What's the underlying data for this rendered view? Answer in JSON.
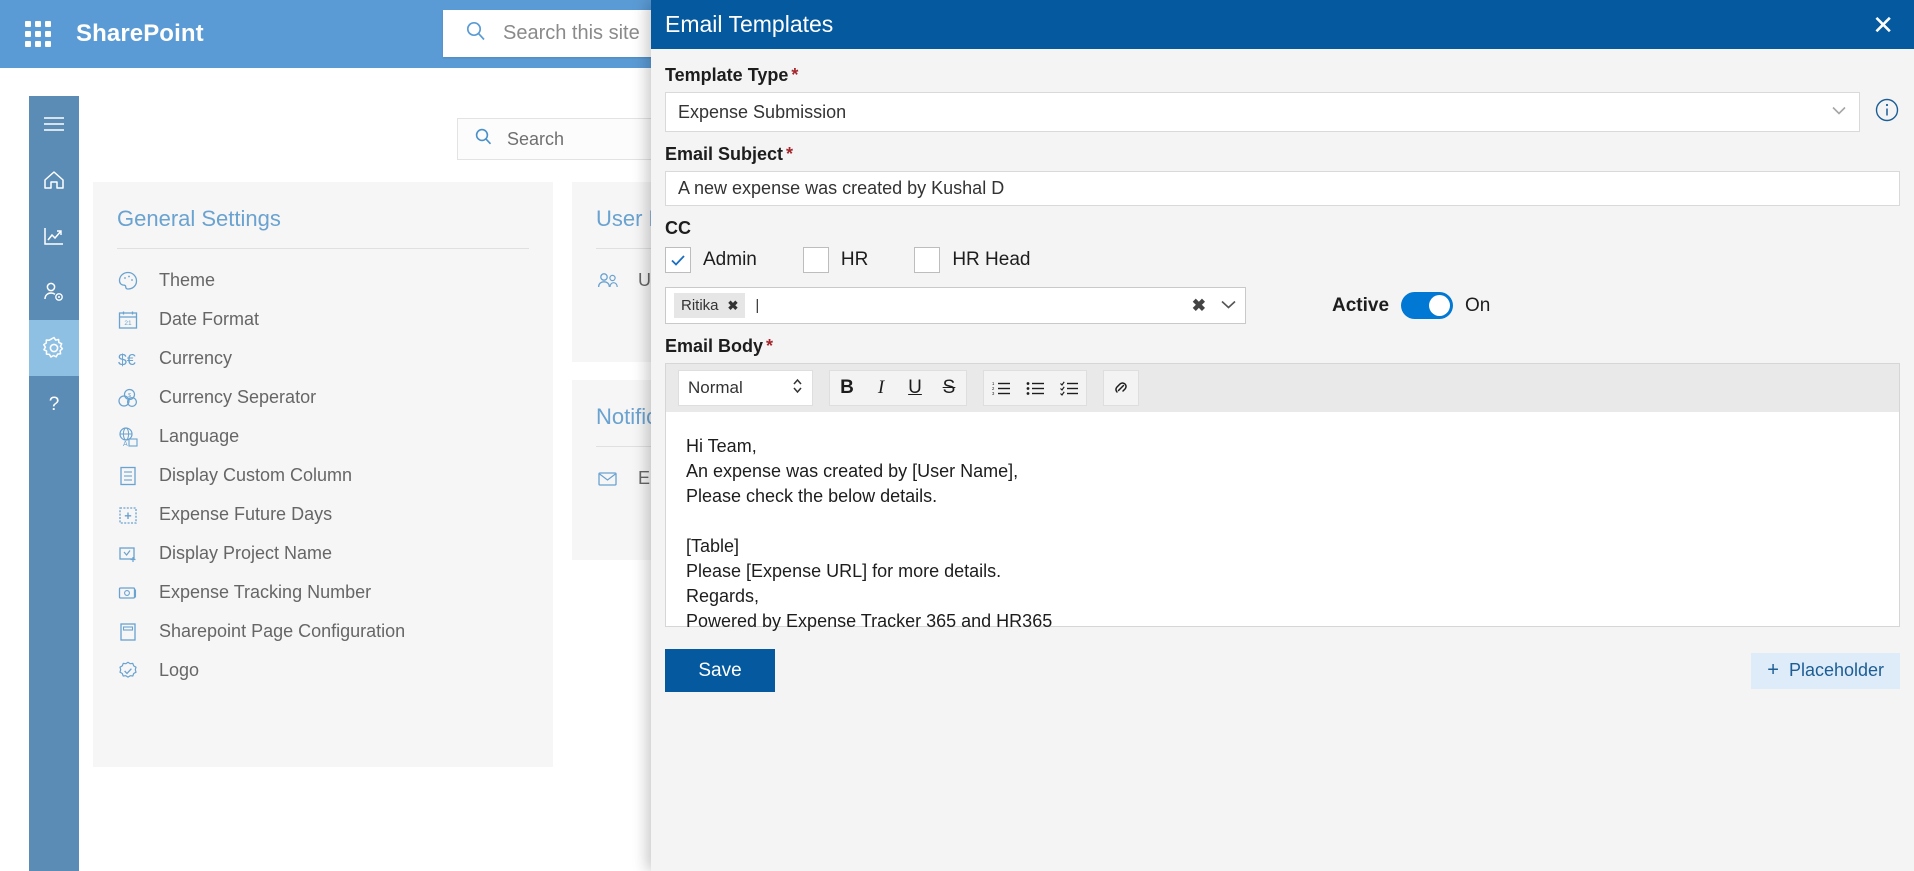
{
  "suitebar": {
    "waffle_name": "app-launcher",
    "brand": "SharePoint",
    "search_placeholder": "Search this site",
    "bg": "#5b9bd5"
  },
  "rail": {
    "items": [
      {
        "icon": "hamburger-icon",
        "name": "menu",
        "active": false
      },
      {
        "icon": "home-icon",
        "name": "home",
        "active": false
      },
      {
        "icon": "chart-icon",
        "name": "reports",
        "active": false
      },
      {
        "icon": "user-settings-icon",
        "name": "user-management",
        "active": false
      },
      {
        "icon": "gear-icon",
        "name": "settings",
        "active": true
      },
      {
        "icon": "help-icon",
        "name": "help",
        "active": false
      }
    ]
  },
  "page": {
    "search_placeholder": "Search"
  },
  "cards": {
    "general": {
      "title": "General Settings",
      "items": [
        {
          "icon": "palette-icon",
          "label": "Theme"
        },
        {
          "icon": "calendar-icon",
          "label": "Date Format"
        },
        {
          "icon": "currency-icon",
          "label": "Currency"
        },
        {
          "icon": "coins-icon",
          "label": "Currency Seperator"
        },
        {
          "icon": "language-icon",
          "label": "Language"
        },
        {
          "icon": "list-icon",
          "label": "Display Custom Column"
        },
        {
          "icon": "calendar-plus-icon",
          "label": "Expense Future Days"
        },
        {
          "icon": "folder-check-icon",
          "label": "Display Project Name"
        },
        {
          "icon": "money-icon",
          "label": "Expense Tracking Number"
        },
        {
          "icon": "page-icon",
          "label": "Sharepoint Page Configuration"
        },
        {
          "icon": "badge-check-icon",
          "label": "Logo"
        }
      ]
    },
    "user_roles": {
      "title": "User Roles",
      "items": [
        {
          "icon": "users-icon",
          "label": "Users"
        }
      ]
    },
    "notifications": {
      "title": "Notifications",
      "items": [
        {
          "icon": "email-template-icon",
          "label": "Email Templates"
        }
      ]
    }
  },
  "panel": {
    "title": "Email Templates",
    "close_label": "✕",
    "template_type": {
      "label": "Template Type",
      "required": "*",
      "value": "Expense Submission",
      "chevron": "⌄"
    },
    "info_icon_name": "info-icon",
    "email_subject": {
      "label": "Email Subject",
      "required": "*",
      "value": "A new expense was created by Kushal D"
    },
    "cc": {
      "label": "CC",
      "checkboxes": [
        {
          "label": "Admin",
          "checked": true
        },
        {
          "label": "HR",
          "checked": false
        },
        {
          "label": "HR Head",
          "checked": false
        }
      ],
      "picker": {
        "chips": [
          {
            "label": "Ritika",
            "remove": "✖"
          }
        ],
        "clear": "✖",
        "chevron": "⌄"
      }
    },
    "active": {
      "label": "Active",
      "state": "On",
      "on": true,
      "color": "#0078d4"
    },
    "email_body": {
      "label": "Email Body",
      "required": "*",
      "toolbar": {
        "format_value": "Normal",
        "buttons": [
          {
            "name": "bold-icon",
            "glyph": "B"
          },
          {
            "name": "italic-icon",
            "glyph": "I"
          },
          {
            "name": "underline-icon",
            "glyph": "U"
          },
          {
            "name": "strikethrough-icon",
            "glyph": "S"
          }
        ],
        "list_buttons": [
          {
            "name": "ordered-list-icon"
          },
          {
            "name": "bullet-list-icon"
          },
          {
            "name": "check-list-icon"
          }
        ],
        "link_button": {
          "name": "link-icon"
        }
      },
      "content": "Hi Team,\nAn expense was created by [User Name],\nPlease check the below details.\n\n[Table]\nPlease [Expense URL] for more details.\nRegards,\nPowered by Expense Tracker 365 and HR365"
    },
    "save_label": "Save",
    "placeholder_label": "Placeholder",
    "placeholder_plus": "+",
    "header_bg": "#05599e"
  }
}
